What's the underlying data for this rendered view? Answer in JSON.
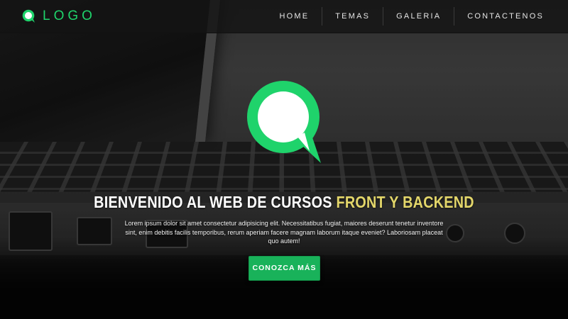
{
  "navbar": {
    "brand_text": "LOGO",
    "items": [
      {
        "label": "HOME"
      },
      {
        "label": "TEMAS"
      },
      {
        "label": "GALERIA"
      },
      {
        "label": "CONTACTENOS"
      }
    ]
  },
  "hero": {
    "title_main": "BIENVENIDO AL WEB DE CURSOS ",
    "title_accent": "FRONT Y BACKEND",
    "description": "Lorem ipsum dolor sit amet consectetur adipisicing elit. Necessitatibus fugiat, maiores deserunt tenetur inventore sint, enim debitis facilis temporibus, rerum aperiam facere magnam laborum itaque eveniet? Laboriosam placeat quo autem!",
    "cta_label": "CONOZCA MÁS"
  },
  "icons": {
    "brand": "chat-bubble-icon",
    "hero": "chat-bubble-icon"
  },
  "colors": {
    "brand_green": "#1fd36b",
    "cta_green": "#19b25a",
    "title_accent": "#e3d66a",
    "navbar_bg": "#141414"
  }
}
